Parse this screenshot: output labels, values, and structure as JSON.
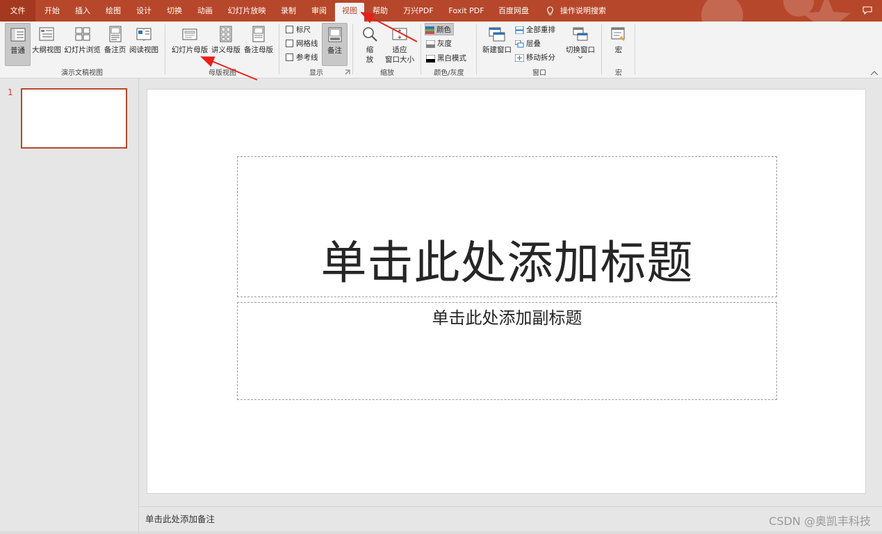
{
  "tabs": [
    {
      "label": "文件"
    },
    {
      "label": "开始"
    },
    {
      "label": "插入"
    },
    {
      "label": "绘图"
    },
    {
      "label": "设计"
    },
    {
      "label": "切换"
    },
    {
      "label": "动画"
    },
    {
      "label": "幻灯片放映"
    },
    {
      "label": "录制"
    },
    {
      "label": "审阅"
    },
    {
      "label": "视图"
    },
    {
      "label": "帮助"
    },
    {
      "label": "万兴PDF"
    },
    {
      "label": "Foxit PDF"
    },
    {
      "label": "百度网盘"
    },
    {
      "label": "操作说明搜索"
    }
  ],
  "active_tab": "视图",
  "accent_color": "#b7472a",
  "ribbon": {
    "presentation_views": {
      "label": "演示文稿视图",
      "buttons": [
        {
          "label": "普通"
        },
        {
          "label": "大纲视图"
        },
        {
          "label": "幻灯片浏览"
        },
        {
          "label": "备注页"
        },
        {
          "label": "阅读视图"
        }
      ]
    },
    "master_views": {
      "label": "母版视图",
      "buttons": [
        {
          "label": "幻灯片母版"
        },
        {
          "label": "讲义母版"
        },
        {
          "label": "备注母版"
        }
      ]
    },
    "show": {
      "label": "显示",
      "checkboxes": [
        {
          "label": "标尺"
        },
        {
          "label": "网格线"
        },
        {
          "label": "参考线"
        }
      ],
      "notes_label": "备注"
    },
    "zoom": {
      "label": "缩放",
      "zoom_line1": "缩",
      "zoom_line2": "放",
      "fit_line1": "适应",
      "fit_line2": "窗口大小"
    },
    "color": {
      "label": "颜色/灰度",
      "items": [
        {
          "label": "颜色"
        },
        {
          "label": "灰度"
        },
        {
          "label": "黑白模式"
        }
      ]
    },
    "window": {
      "label": "窗口",
      "new_window": "新建窗口",
      "items": [
        {
          "label": "全部重排"
        },
        {
          "label": "层叠"
        },
        {
          "label": "移动拆分"
        }
      ],
      "switch_window": "切换窗口"
    },
    "macros": {
      "label": "宏",
      "button": "宏"
    }
  },
  "thumbnails": [
    {
      "number": "1"
    }
  ],
  "slide": {
    "title_placeholder": "单击此处添加标题",
    "subtitle_placeholder": "单击此处添加副标题"
  },
  "notes_placeholder": "单击此处添加备注",
  "watermark": "CSDN @奥凯丰科技"
}
